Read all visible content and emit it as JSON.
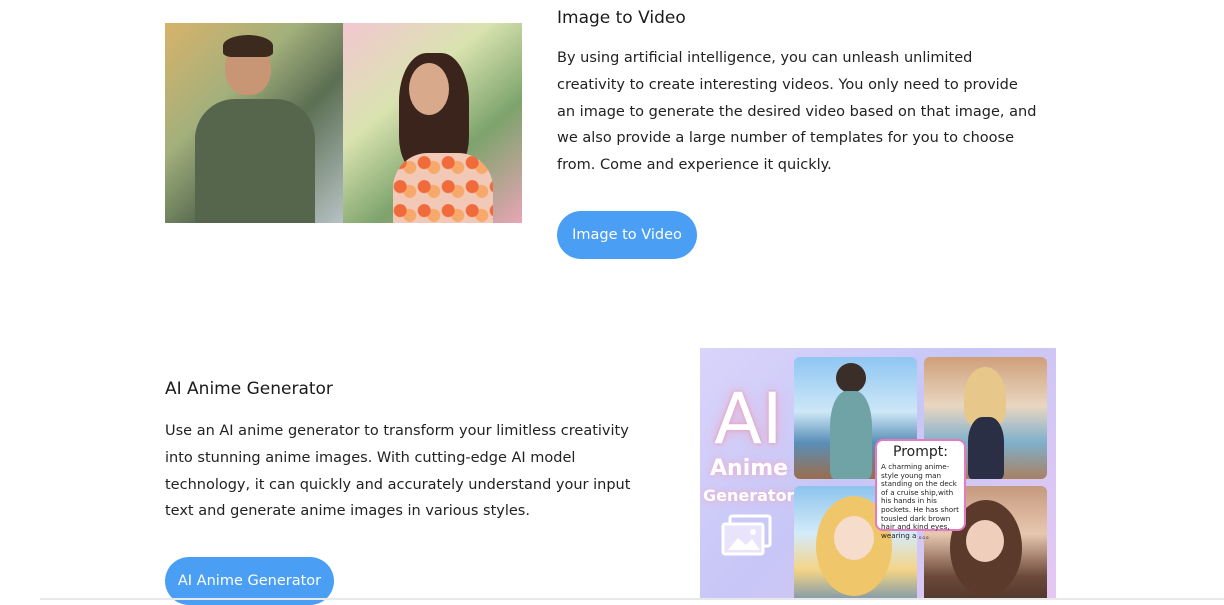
{
  "sections": {
    "image_to_video": {
      "title": "Image to Video",
      "description": "By using artificial intelligence, you can unleash unlimited creativity to create interesting videos. You only need to provide an image to generate the desired video based on that image, and we also provide a large number of templates for you to choose from. Come and experience it quickly.",
      "button_label": "Image to Video"
    },
    "ai_anime": {
      "title": "AI Anime Generator",
      "description": "Use an AI anime generator to transform your limitless creativity into stunning anime images. With cutting-edge AI model technology, it can quickly and accurately understand your input text and generate anime images in various styles.",
      "button_label": "AI Anime Generator",
      "graphic": {
        "big_text": "AI",
        "word_anime": "Anime",
        "word_generator": "Generator",
        "prompt_title": "Prompt:",
        "prompt_text": "A charming anime-style young man standing on the deck of a cruise ship,with his hands in his pockets. He has short tousled dark brown hair and kind eyes, wearing a 。。。"
      }
    }
  },
  "colors": {
    "button": "#4a9ff5",
    "prompt_border": "#e27bc2"
  },
  "icons": [
    "image-icon"
  ]
}
